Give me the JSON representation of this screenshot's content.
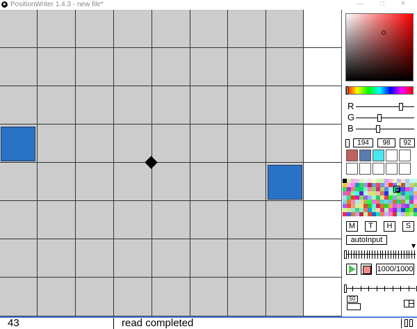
{
  "titlebar": {
    "title": "PositionWriter 1.4.3 - new file*",
    "minimize_glyph": "—",
    "maximize_glyph": "□",
    "close_glyph": "✕"
  },
  "canvas": {
    "grid_columns": 9,
    "grid_rows": 8,
    "cell_color": "#cdcccd",
    "square_color": "#2a72c6",
    "marker_icon": "diamond-icon"
  },
  "color_picker": {
    "channel_labels": {
      "r": "R",
      "g": "G",
      "b": "B"
    },
    "value_r": "194",
    "value_g": "98",
    "value_b": "92"
  },
  "swatches": {
    "row1": [
      "#c0625c",
      "#5a7ab0",
      "#4ae6f0",
      "#ffffff",
      "#ffffff"
    ],
    "row2": [
      "#ffffff",
      "#ffffff",
      "#ffffff",
      "#ffffff",
      "#ffffff"
    ]
  },
  "mode_buttons": {
    "m": "M",
    "t": "T",
    "h": "H",
    "s": "S"
  },
  "auto_input": "autoInput",
  "player": {
    "frame_counter": "1000/1000",
    "speed_value": "50"
  },
  "status": {
    "count": "43",
    "message": "read completed"
  }
}
